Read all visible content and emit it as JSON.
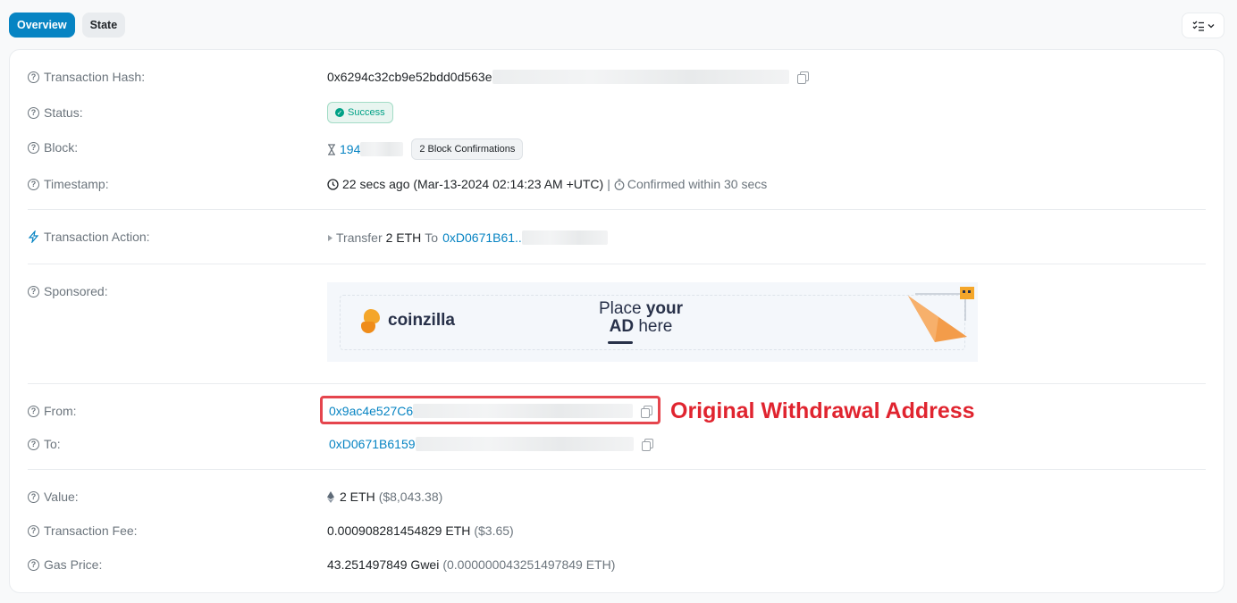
{
  "tabs": {
    "overview": "Overview",
    "state": "State"
  },
  "menu": {
    "icon": "list-check-icon",
    "chevron": "chevron-down-icon"
  },
  "tx_hash": {
    "label": "Transaction Hash:",
    "value": "0x6294c32cb9e52bdd0d563e"
  },
  "status": {
    "label": "Status:",
    "badge": "Success"
  },
  "block": {
    "label": "Block:",
    "value": "194",
    "confirmations": "2 Block Confirmations"
  },
  "timestamp": {
    "label": "Timestamp:",
    "value": "22 secs ago (Mar-13-2024 02:14:23 AM +UTC)",
    "separator": "|",
    "confirmed": "Confirmed within 30 secs"
  },
  "action": {
    "label": "Transaction Action:",
    "transfer": "Transfer",
    "amount": "2 ETH",
    "to_word": "To",
    "address": "0xD0671B61.."
  },
  "sponsored": {
    "label": "Sponsored:",
    "brand": "coinzilla",
    "place": "Place",
    "your": "your",
    "ad": "AD",
    "here": "here",
    "accent_color": "#f39c4a"
  },
  "from": {
    "label": "From:",
    "address": "0x9ac4e527C6"
  },
  "to": {
    "label": "To:",
    "address": "0xD0671B6159"
  },
  "value": {
    "label": "Value:",
    "amount": "2 ETH",
    "usd": "($8,043.38)"
  },
  "fee": {
    "label": "Transaction Fee:",
    "amount": "0.000908281454829 ETH",
    "usd": "($3.65)"
  },
  "gas": {
    "label": "Gas Price:",
    "gwei": "43.251497849 Gwei",
    "open_paren": "(",
    "eth": "0.000000043251497849 ETH)"
  },
  "annotation": {
    "text": "Original Withdrawal Address",
    "color": "#e0242f"
  },
  "colors": {
    "link": "#0784c3",
    "success": "#00a186",
    "tab_active": "#0784c3"
  }
}
